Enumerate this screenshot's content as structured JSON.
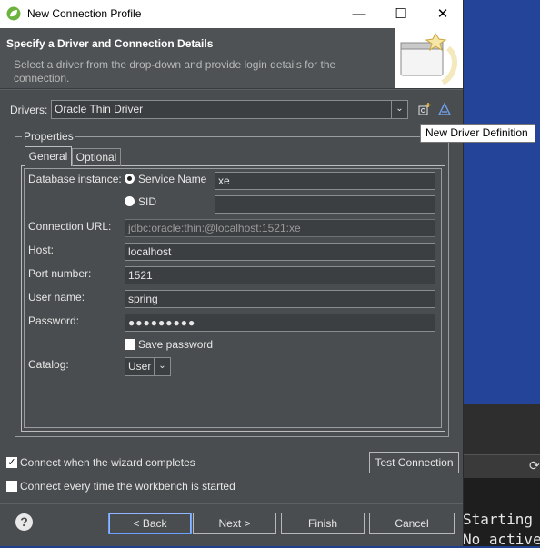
{
  "window": {
    "title": "New Connection Profile",
    "minimize": "—",
    "maximize": "☐",
    "close": "✕"
  },
  "header": {
    "title": "Specify a Driver and Connection Details",
    "description": "Select a driver from the drop-down and provide login details for the connection."
  },
  "drivers": {
    "label": "Drivers:",
    "value": "Oracle Thin Driver",
    "new_driver_icon": "new-driver-icon",
    "edit_driver_icon": "edit-driver-icon",
    "tooltip": "New Driver Definition"
  },
  "properties": {
    "legend": "Properties",
    "tabs": [
      "General",
      "Optional"
    ],
    "database_instance_label": "Database instance:",
    "service_name_label": "Service Name",
    "service_name_value": "xe",
    "sid_label": "SID",
    "sid_value": "",
    "connection_url_label": "Connection URL:",
    "connection_url_value": "jdbc:oracle:thin:@localhost:1521:xe",
    "host_label": "Host:",
    "host_value": "localhost",
    "port_label": "Port number:",
    "port_value": "1521",
    "user_label": "User name:",
    "user_value": "spring",
    "password_label": "Password:",
    "password_value": "●●●●●●●●●",
    "save_password_label": "Save password",
    "catalog_label": "Catalog:",
    "catalog_value": "User"
  },
  "options": {
    "connect_when_complete": "Connect when the wizard completes",
    "connect_every_time": "Connect every time the workbench is started",
    "test_connection": "Test Connection"
  },
  "footer": {
    "help": "?",
    "back": "< Back",
    "next": "Next >",
    "finish": "Finish",
    "cancel": "Cancel"
  },
  "background": {
    "console_line1": "Starting",
    "console_line2": "No active"
  }
}
